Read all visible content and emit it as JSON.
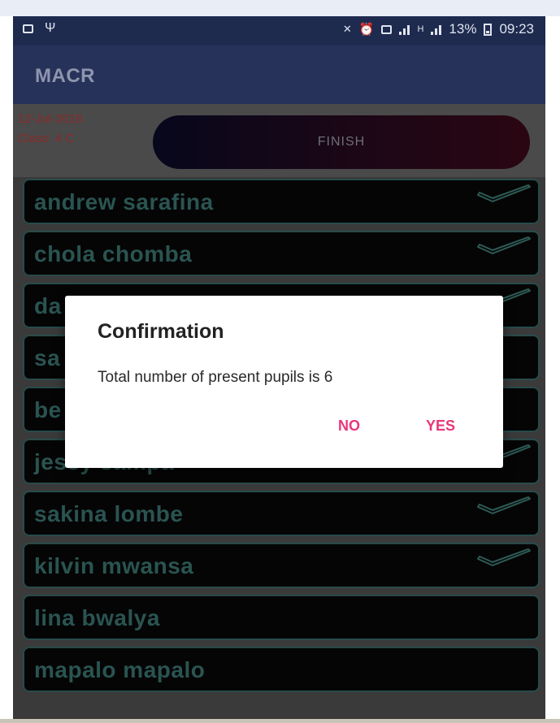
{
  "status_bar": {
    "battery_percent": "13%",
    "time": "09:23",
    "left_icons": [
      "image-icon",
      "usb-icon"
    ],
    "right_icons": [
      "mute-icon",
      "alarm-icon",
      "data-icon",
      "signal-icon",
      "network-h-icon",
      "signal-2-icon",
      "battery-icon"
    ]
  },
  "app_bar": {
    "title": "MACR"
  },
  "info": {
    "date": "12-Jul-2018",
    "class": "Class: 4 C",
    "finish_label": "FINISH"
  },
  "pupils": [
    {
      "name": "andrew sarafina",
      "checked": true
    },
    {
      "name": "chola chomba",
      "checked": true
    },
    {
      "name": "da",
      "checked": true
    },
    {
      "name": "sa",
      "checked": false
    },
    {
      "name": "be",
      "checked": false
    },
    {
      "name": "jessy sampa",
      "checked": true
    },
    {
      "name": "sakina lombe",
      "checked": true
    },
    {
      "name": "kilvin mwansa",
      "checked": true
    },
    {
      "name": "lina bwalya",
      "checked": false
    },
    {
      "name": "mapalo mapalo",
      "checked": false
    }
  ],
  "dialog": {
    "title": "Confirmation",
    "message": "Total number of present pupils is 6",
    "no_label": "NO",
    "yes_label": "YES"
  },
  "colors": {
    "app_bar": "#26325a",
    "status_bar": "#1e2a4e",
    "accent": "#e8357a",
    "pupil_text": "#2a5451",
    "info_text": "#8a2a2a"
  }
}
